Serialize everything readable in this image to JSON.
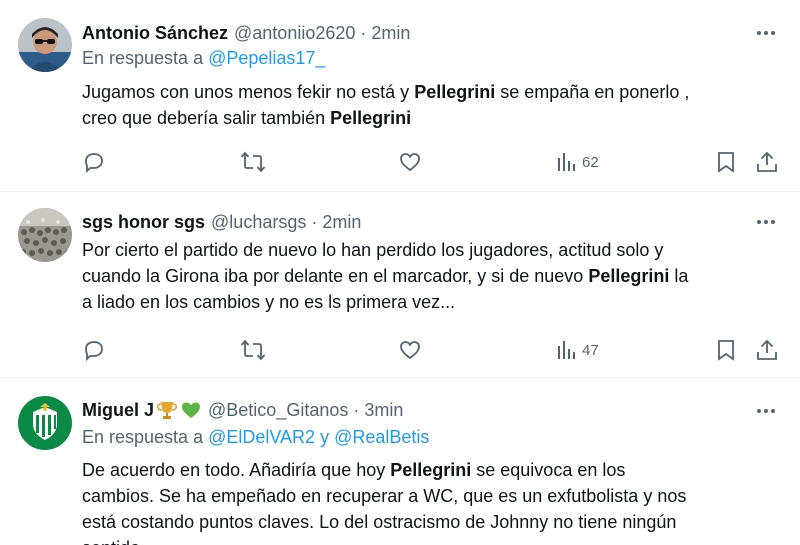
{
  "colors": {
    "text": "#0f1419",
    "muted": "#536471",
    "link": "#1d9bf0",
    "divider": "#eff3f4"
  },
  "tweets": [
    {
      "name": "Antonio Sánchez",
      "handle": "@antoniio2620",
      "sep": "·",
      "time": "2min",
      "reply_prefix": "En respuesta a",
      "reply_to": "@Pepelias17_",
      "line1_a": "Jugamos con unos menos fekir no está y ",
      "line1_b": "Pellegrini",
      "line1_c": " se empaña en ponerlo ,",
      "line2_a": "creo que debería salir también ",
      "line2_b": "Pellegrini",
      "views": "62",
      "icons": [
        "reply-icon",
        "retweet-icon",
        "like-icon",
        "views-icon",
        "bookmark-icon",
        "share-icon"
      ]
    },
    {
      "name": "sgs honor sgs",
      "handle": "@lucharsgs",
      "sep": "·",
      "time": "2min",
      "line1": "Por cierto el partido de nuevo lo han perdido los jugadores, actitud solo y",
      "line2_a": "cuando la Girona iba por delante en el marcador, y si de nuevo ",
      "line2_b": "Pellegrini",
      "line2_c": " la",
      "line3": "a liado en los cambios y no es ls primera vez...",
      "views": "47"
    },
    {
      "name": "Miguel J",
      "name_emoji": [
        "trophy-emoji",
        "green-heart-emoji"
      ],
      "handle": "@Betico_Gitanos",
      "sep": "·",
      "time": "3min",
      "reply_prefix": "En respuesta a",
      "reply_to_1": "@ElDelVAR2",
      "reply_and": " y ",
      "reply_to_2": "@RealBetis",
      "line1_a": "De acuerdo en todo. Añadiría que hoy ",
      "line1_b": "Pellegrini",
      "line1_c": " se equivoca en los",
      "line2": "cambios. Se ha empeñado en recuperar a WC, que es un exfutbolista y nos",
      "line3": "está costando puntos claves. Lo del ostracismo de Johnny no tiene ningún",
      "line4": "sentido"
    }
  ]
}
